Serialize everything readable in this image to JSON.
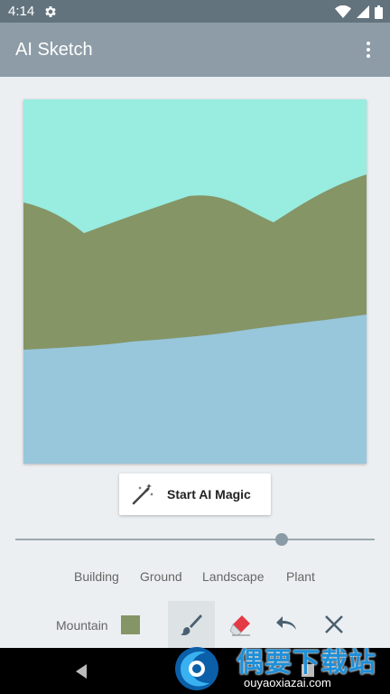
{
  "status_bar": {
    "time": "4:14",
    "icons": [
      "settings-gear-icon",
      "wifi-icon",
      "cellular-icon",
      "battery-icon"
    ]
  },
  "app_bar": {
    "title": "AI Sketch",
    "menu_icon": "overflow-menu-icon"
  },
  "canvas": {
    "colors": {
      "sky": "#98ece0",
      "mountain": "#859566",
      "water": "#98c6db"
    }
  },
  "magic_button": {
    "label": "Start AI Magic",
    "icon": "magic-wand-icon"
  },
  "brush_size_slider": {
    "value_fraction": 0.74
  },
  "categories": [
    "Building",
    "Ground",
    "Landscape",
    "Plant"
  ],
  "toolbar": {
    "current_material": "Mountain",
    "current_color": "#859566",
    "tools": [
      "brush-icon",
      "eraser-icon",
      "undo-icon",
      "clear-icon"
    ],
    "active_tool": "brush-icon"
  },
  "nav_bar": {
    "buttons": [
      "back-icon",
      "home-icon",
      "recents-icon"
    ]
  },
  "watermark": {
    "main": "偶要下载站",
    "sub": "ouyaoxiazai.com"
  }
}
